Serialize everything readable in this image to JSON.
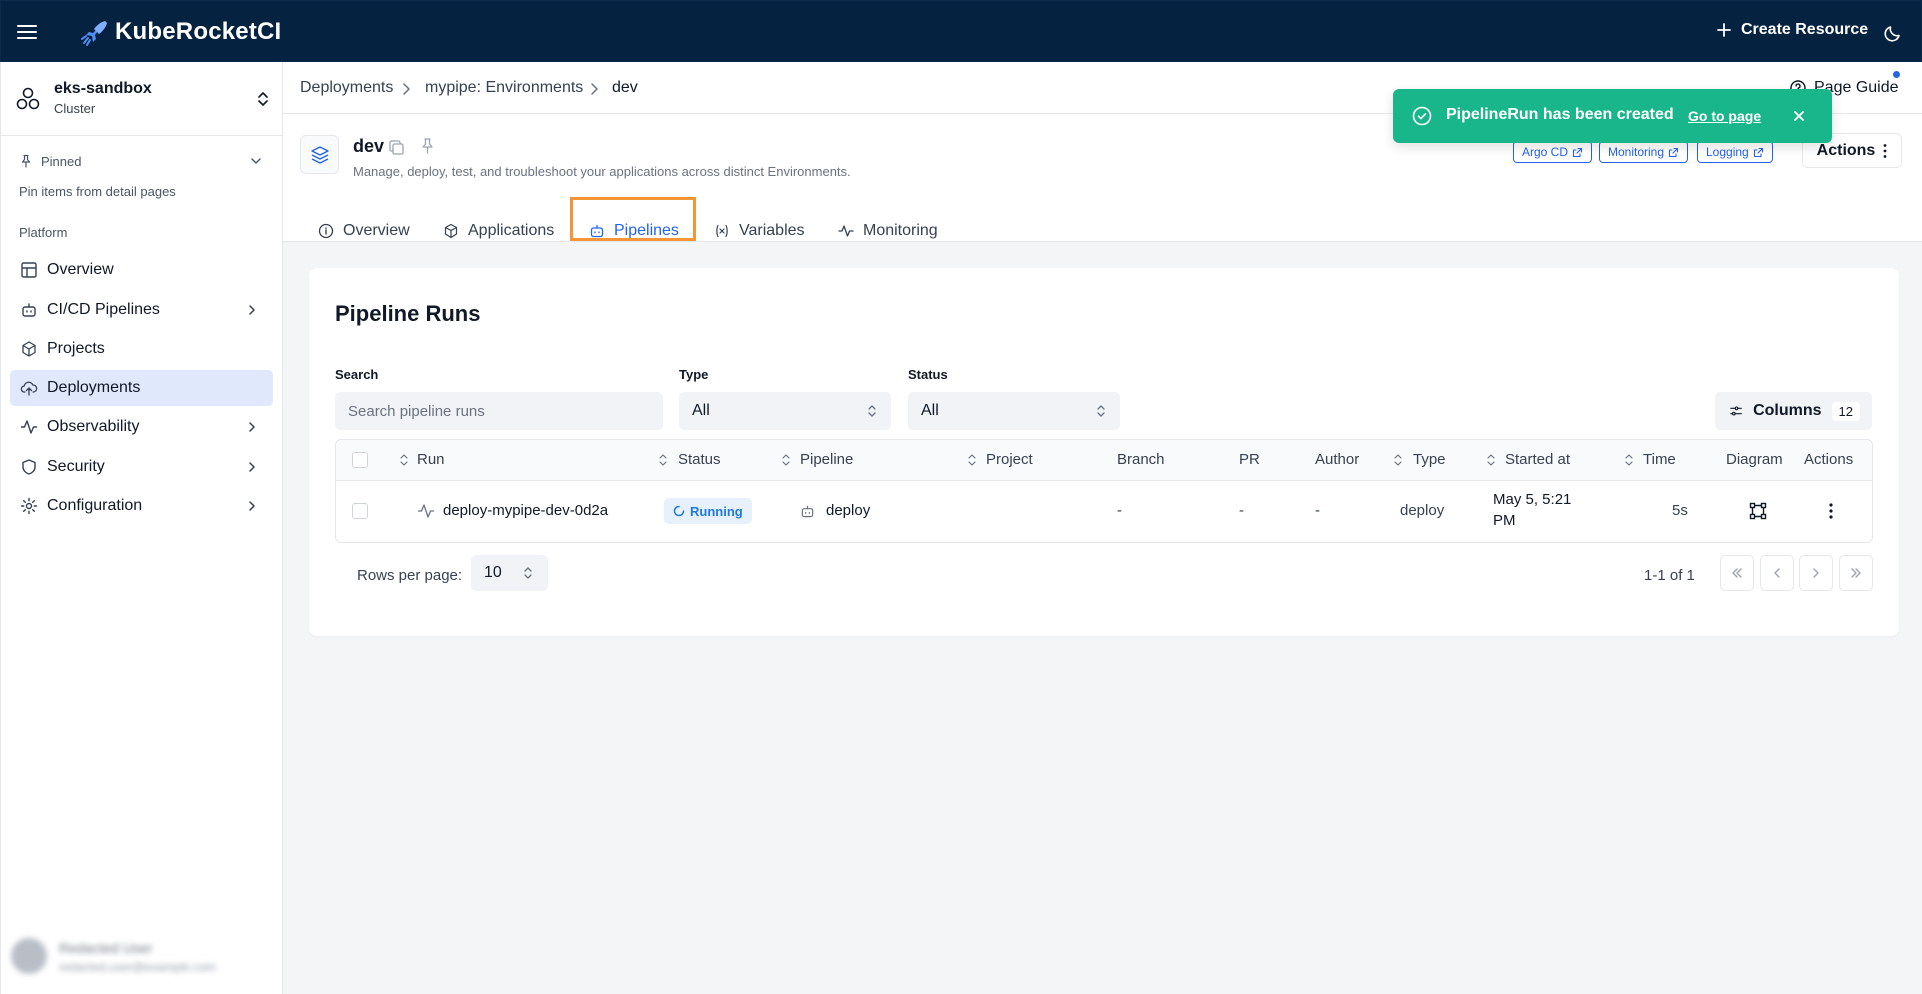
{
  "app": {
    "brand": "KubeRocketCI",
    "create_resource": "Create Resource"
  },
  "sidebar": {
    "cluster_name": "eks-sandbox",
    "cluster_type": "Cluster",
    "pinned_label": "Pinned",
    "pin_hint": "Pin items from detail pages",
    "section_label": "Platform",
    "items": [
      {
        "label": "Overview",
        "icon": "layout-icon",
        "has_children": false
      },
      {
        "label": "CI/CD Pipelines",
        "icon": "bot-icon",
        "has_children": true
      },
      {
        "label": "Projects",
        "icon": "box-icon",
        "has_children": false
      },
      {
        "label": "Deployments",
        "icon": "cloud-upload-icon",
        "has_children": false,
        "active": true
      },
      {
        "label": "Observability",
        "icon": "activity-icon",
        "has_children": true
      },
      {
        "label": "Security",
        "icon": "shield-icon",
        "has_children": true
      },
      {
        "label": "Configuration",
        "icon": "gear-icon",
        "has_children": true
      }
    ],
    "user_name": "Redacted User",
    "user_email": "redacted.user@example.com"
  },
  "breadcrumbs": [
    "Deployments",
    "mypipe: Environments",
    "dev"
  ],
  "page_guide": "Page Guide",
  "header": {
    "title": "dev",
    "description": "Manage, deploy, test, and troubleshoot your applications across distinct Environments.",
    "links": [
      "Argo CD",
      "Monitoring",
      "Logging"
    ],
    "actions_label": "Actions"
  },
  "tabs": [
    {
      "label": "Overview",
      "icon": "info-icon"
    },
    {
      "label": "Applications",
      "icon": "box-icon"
    },
    {
      "label": "Pipelines",
      "icon": "bot-icon",
      "active": true
    },
    {
      "label": "Variables",
      "icon": "variable-icon"
    },
    {
      "label": "Monitoring",
      "icon": "activity-icon"
    }
  ],
  "pipeline_runs": {
    "title": "Pipeline Runs",
    "filters": {
      "search_label": "Search",
      "search_placeholder": "Search pipeline runs",
      "type_label": "Type",
      "type_value": "All",
      "status_label": "Status",
      "status_value": "All"
    },
    "columns_label": "Columns",
    "columns_count": "12",
    "headers": [
      "Run",
      "Status",
      "Pipeline",
      "Project",
      "Branch",
      "PR",
      "Author",
      "Type",
      "Started at",
      "Time",
      "Diagram",
      "Actions"
    ],
    "rows": [
      {
        "run": "deploy-mypipe-dev-0d2a",
        "status": "Running",
        "pipeline": "deploy",
        "project": "",
        "branch": "-",
        "pr": "-",
        "author": "-",
        "type": "deploy",
        "started_line1": "May 5, 5:21",
        "started_line2": "PM",
        "time": "5s"
      }
    ],
    "rows_per_page_label": "Rows per page:",
    "rows_per_page_value": "10",
    "range_text": "1-1 of 1"
  },
  "toast": {
    "message": "PipelineRun has been created",
    "link": "Go to page"
  },
  "colors": {
    "topbar": "#062241",
    "accent": "#2563eb",
    "toast": "#19b68b",
    "highlight": "#f59536"
  }
}
